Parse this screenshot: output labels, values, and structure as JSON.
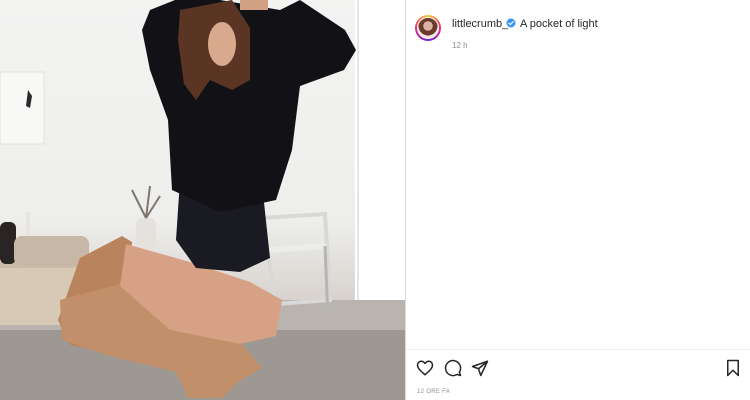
{
  "post": {
    "username": "littlecrumb_",
    "caption": "A pocket of light",
    "relative_time": "12 h",
    "date_label": "12 ORE FA"
  },
  "icons": {
    "verified": "verified-badge-icon",
    "like": "heart-icon",
    "comment": "comment-icon",
    "share": "share-icon",
    "save": "bookmark-icon"
  },
  "colors": {
    "verified": "#3897f0",
    "text": "#262626",
    "muted": "#8e8e8e"
  }
}
